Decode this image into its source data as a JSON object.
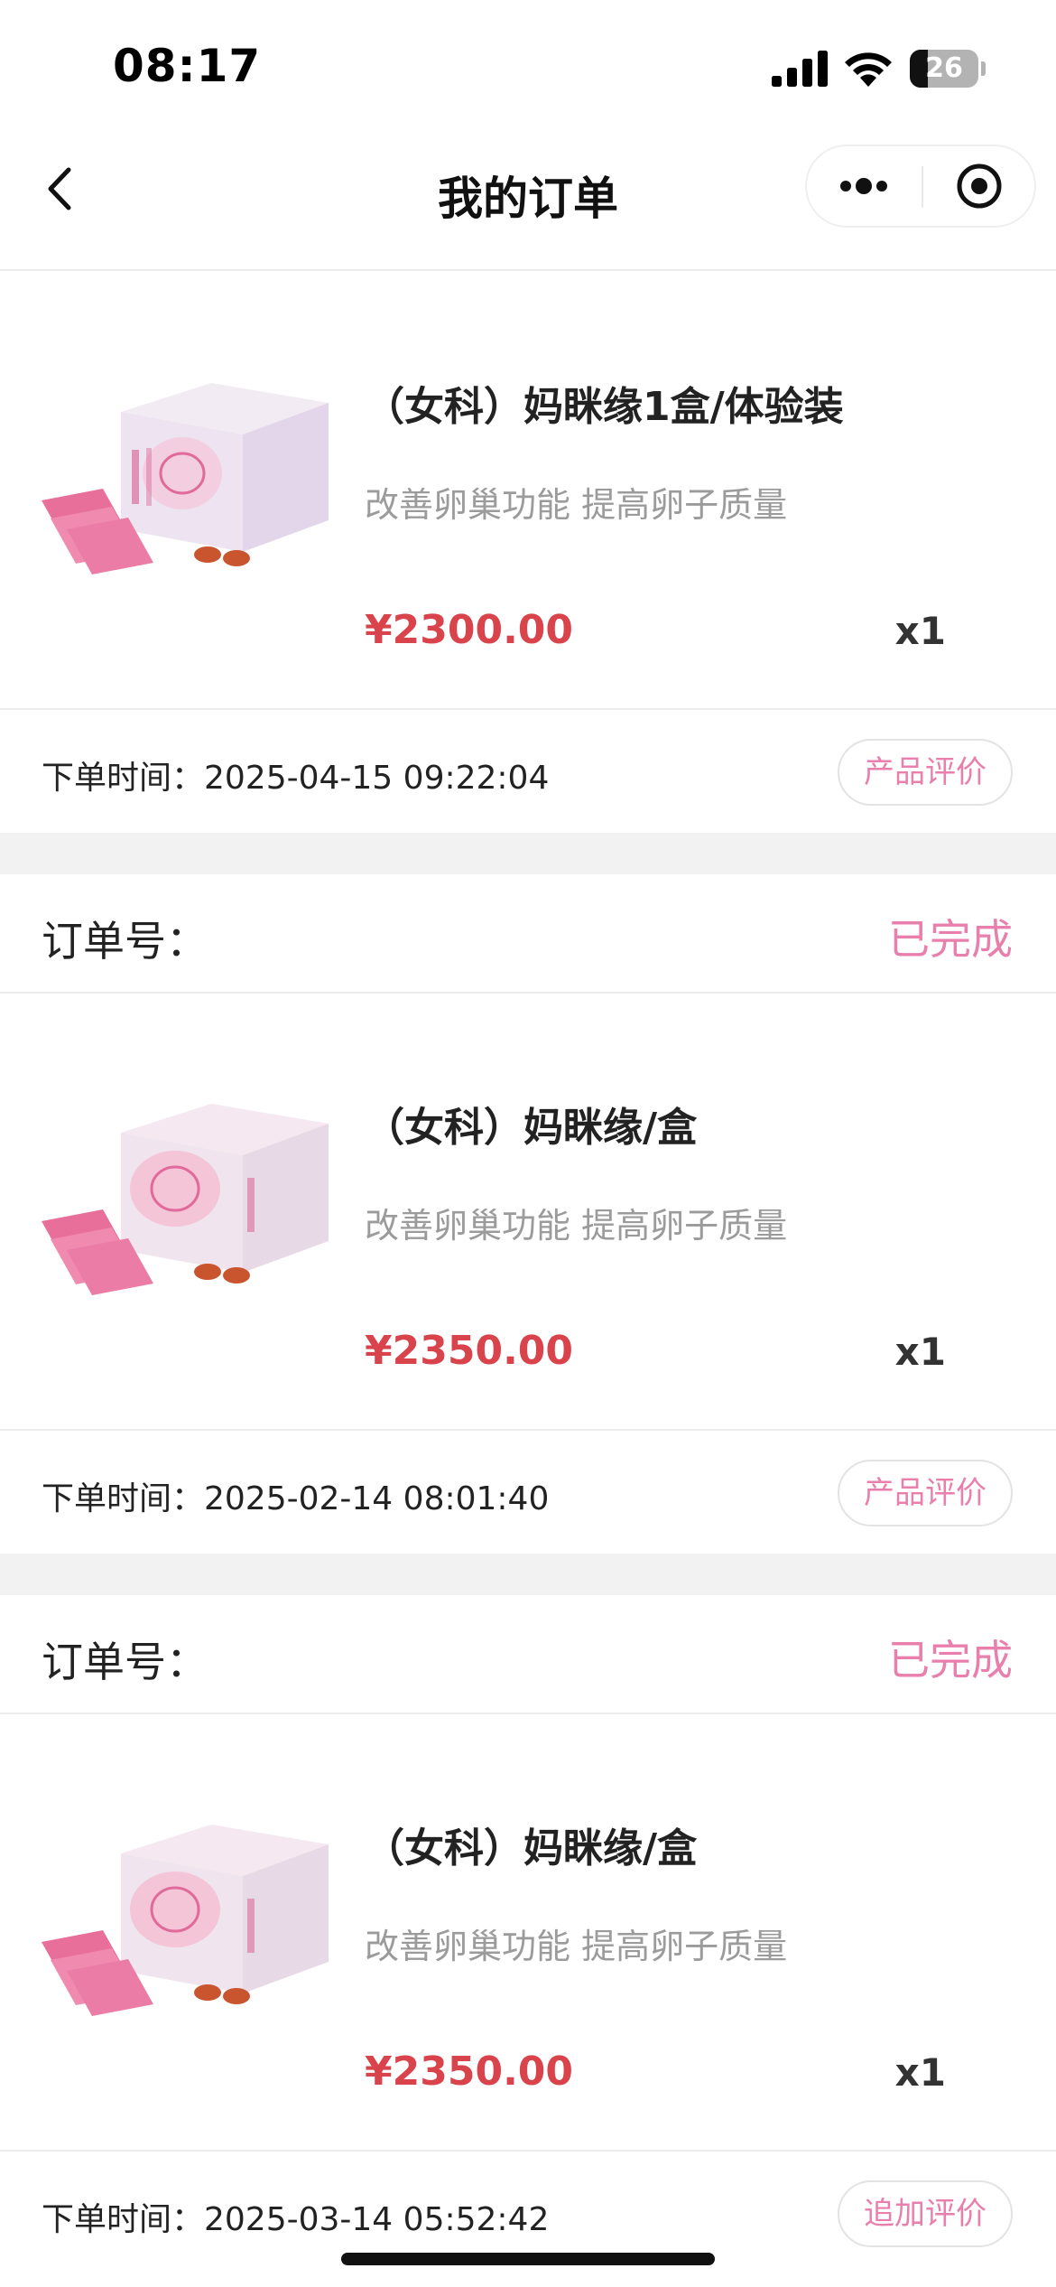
{
  "status_bar": {
    "time": "08:17",
    "battery": "26",
    "battery_level": 0.26
  },
  "nav": {
    "title": "我的订单",
    "back_icon": "chevron-left-icon",
    "more_icon": "more-dots-icon",
    "close_icon": "target-circle-icon"
  },
  "colors": {
    "accent_pink": "#e87fac",
    "price_red": "#d8434c",
    "muted_gray": "#9b9b9b",
    "divider": "#ececec",
    "gap": "#f2f2f2"
  },
  "orders": [
    {
      "order_no_label": "",
      "status": "",
      "product_name": "（女科）妈眯缘1盒/体验装",
      "product_desc": "改善卵巢功能 提高卵子质量",
      "price": "¥2300.00",
      "qty": "x1",
      "time": "下单时间：2025-04-15 09:22:04",
      "action": "产品评价"
    },
    {
      "order_no_label": "订单号：",
      "status": "已完成",
      "product_name": "（女科）妈眯缘/盒",
      "product_desc": "改善卵巢功能 提高卵子质量",
      "price": "¥2350.00",
      "qty": "x1",
      "time": "下单时间：2025-02-14 08:01:40",
      "action": "产品评价"
    },
    {
      "order_no_label": "订单号：",
      "status": "已完成",
      "product_name": "（女科）妈眯缘/盒",
      "product_desc": "改善卵巢功能 提高卵子质量",
      "price": "¥2350.00",
      "qty": "x1",
      "time": "下单时间：2025-03-14 05:52:42",
      "action": "追加评价"
    }
  ]
}
